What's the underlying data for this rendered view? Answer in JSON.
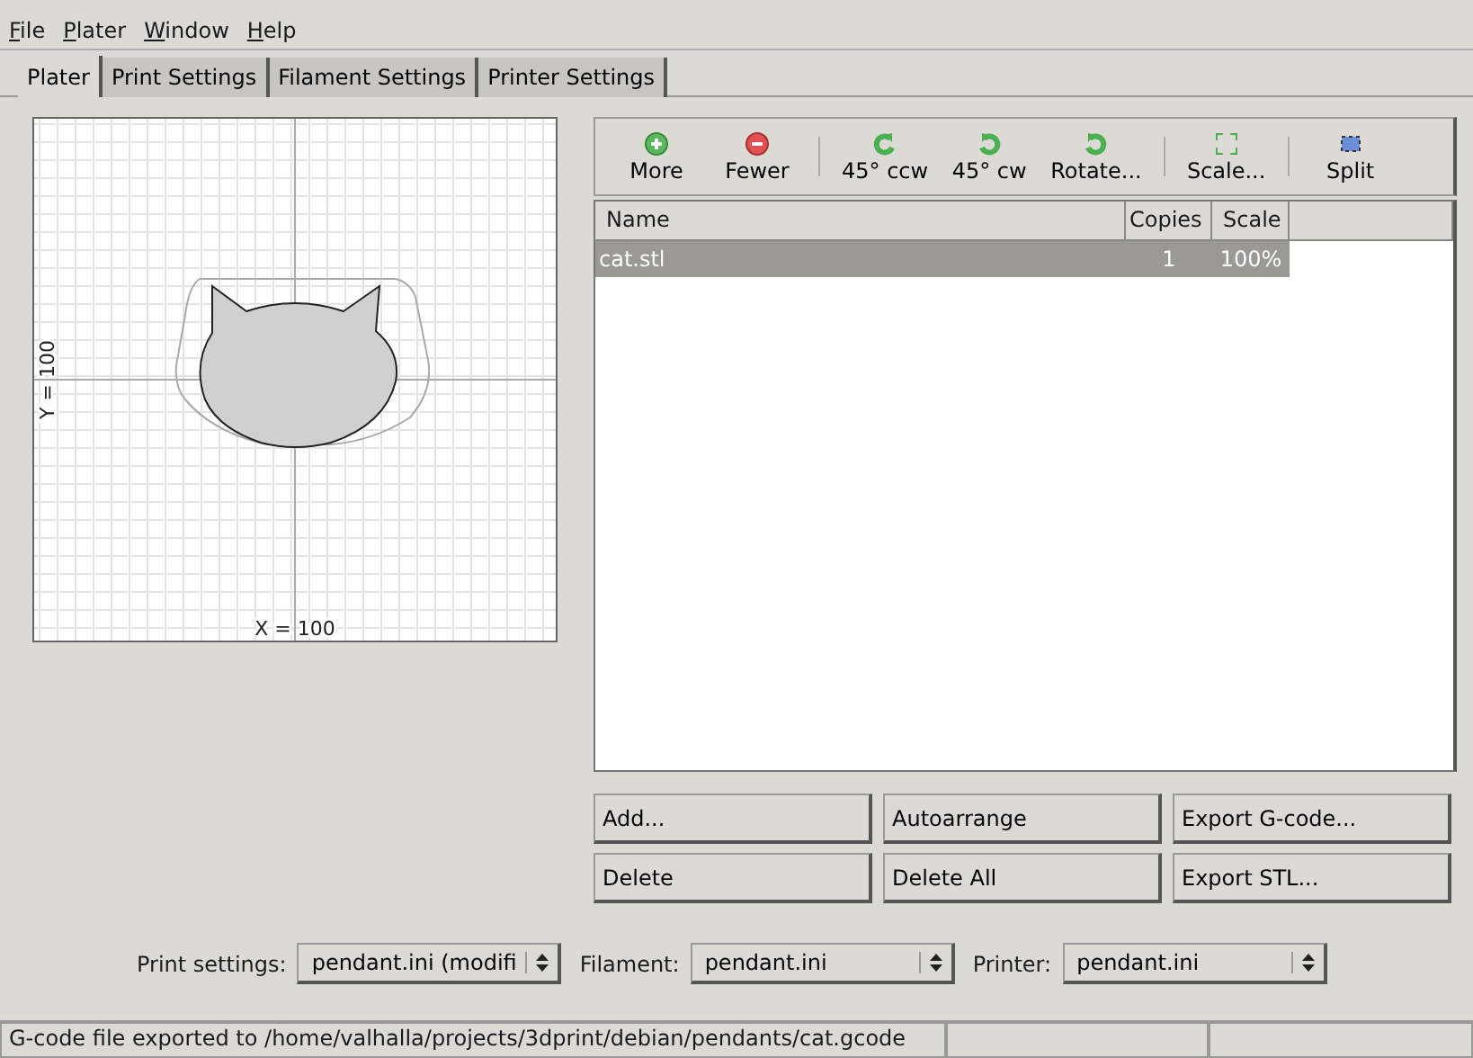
{
  "menu": [
    "File",
    "Plater",
    "Window",
    "Help"
  ],
  "tabs": [
    {
      "label": "Plater",
      "selected": true
    },
    {
      "label": "Print Settings",
      "selected": false
    },
    {
      "label": "Filament Settings",
      "selected": false
    },
    {
      "label": "Printer Settings",
      "selected": false
    }
  ],
  "plate": {
    "x_label": "X = 100",
    "y_label": "Y = 100"
  },
  "toolbar": [
    {
      "kind": "plus",
      "label": "More"
    },
    {
      "kind": "minus",
      "label": "Fewer"
    },
    {
      "kind": "sep"
    },
    {
      "kind": "ccw",
      "label": "45° ccw"
    },
    {
      "kind": "cw",
      "label": "45° cw"
    },
    {
      "kind": "cw",
      "label": "Rotate..."
    },
    {
      "kind": "sep"
    },
    {
      "kind": "scale",
      "label": "Scale..."
    },
    {
      "kind": "sep"
    },
    {
      "kind": "split",
      "label": "Split"
    }
  ],
  "table": {
    "columns": [
      "Name",
      "Copies",
      "Scale"
    ],
    "rows": [
      {
        "name": "cat.stl",
        "copies": "1",
        "scale": "100%",
        "selected": true
      }
    ]
  },
  "buttons": [
    "Add...",
    "Autoarrange",
    "Export G-code...",
    "Delete",
    "Delete All",
    "Export STL..."
  ],
  "selectors": [
    {
      "label": "Print settings:",
      "value": "pendant.ini (modifi"
    },
    {
      "label": "Filament:",
      "value": "pendant.ini"
    },
    {
      "label": "Printer:",
      "value": "pendant.ini"
    }
  ],
  "status_bar": "G-code file exported to /home/valhalla/projects/3dprint/debian/pendants/cat.gcode"
}
